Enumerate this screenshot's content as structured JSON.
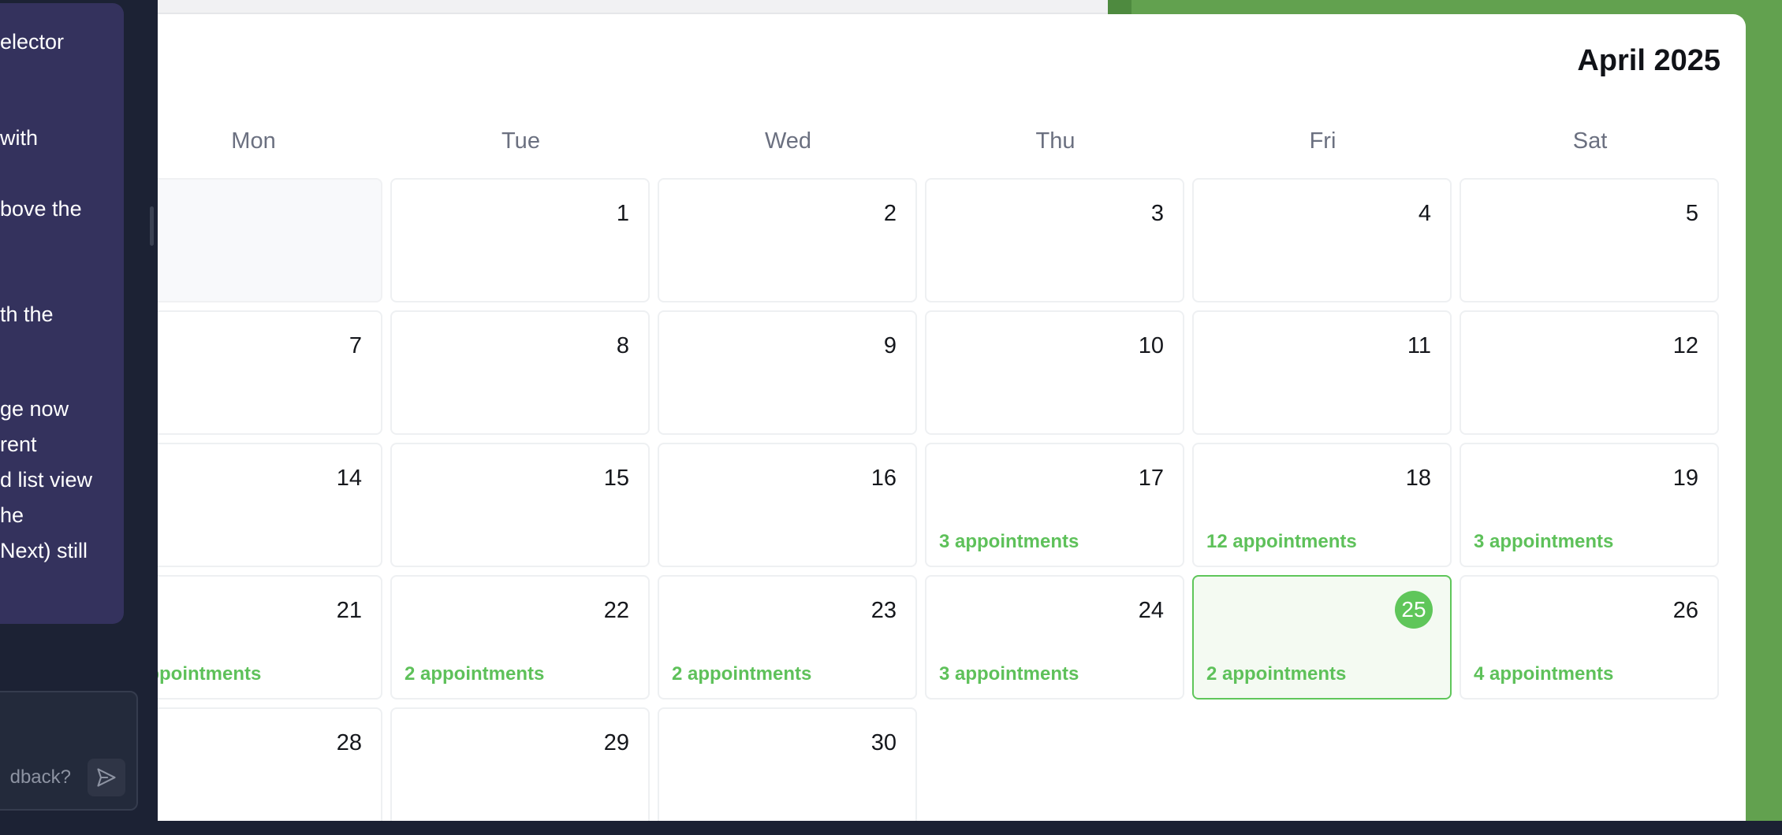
{
  "chat": {
    "message_lines": [
      "elector",
      "with",
      "bove the",
      "th the",
      "ge now",
      "rent",
      "d list view",
      "he",
      "Next) still"
    ],
    "feedback_placeholder": "dback?"
  },
  "calendar": {
    "month_title": "April 2025",
    "weekdays": [
      "Mon",
      "Tue",
      "Wed",
      "Thu",
      "Fri",
      "Sat"
    ],
    "days": [
      {
        "num": "",
        "appt": "",
        "today": false,
        "empty": true
      },
      {
        "num": "1",
        "appt": ""
      },
      {
        "num": "2",
        "appt": ""
      },
      {
        "num": "3",
        "appt": ""
      },
      {
        "num": "4",
        "appt": ""
      },
      {
        "num": "5",
        "appt": ""
      },
      {
        "num": "7",
        "appt": ""
      },
      {
        "num": "8",
        "appt": ""
      },
      {
        "num": "9",
        "appt": ""
      },
      {
        "num": "10",
        "appt": ""
      },
      {
        "num": "11",
        "appt": ""
      },
      {
        "num": "12",
        "appt": ""
      },
      {
        "num": "14",
        "appt": ""
      },
      {
        "num": "15",
        "appt": ""
      },
      {
        "num": "16",
        "appt": ""
      },
      {
        "num": "17",
        "appt": "3 appointments"
      },
      {
        "num": "18",
        "appt": "12 appointments"
      },
      {
        "num": "19",
        "appt": "3 appointments"
      },
      {
        "num": "21",
        "appt": "appointments"
      },
      {
        "num": "22",
        "appt": "2 appointments"
      },
      {
        "num": "23",
        "appt": "2 appointments"
      },
      {
        "num": "24",
        "appt": "3 appointments"
      },
      {
        "num": "25",
        "appt": "2 appointments",
        "today": true
      },
      {
        "num": "26",
        "appt": "4 appointments"
      },
      {
        "num": "28",
        "appt": ""
      },
      {
        "num": "29",
        "appt": ""
      },
      {
        "num": "30",
        "appt": ""
      }
    ]
  },
  "colors": {
    "accent_green": "#5fc65a",
    "background_green": "#62a14f",
    "chat_card": "#34325d"
  },
  "icons": {
    "send": "send-icon"
  }
}
